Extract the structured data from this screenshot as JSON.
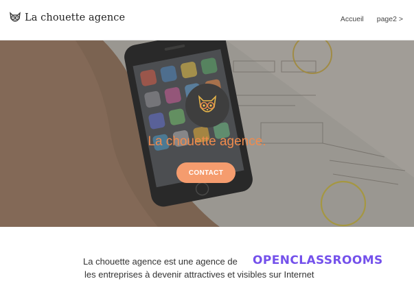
{
  "header": {
    "brand": "La chouette agence",
    "nav": [
      {
        "label": "Accueil"
      },
      {
        "label": "page2 >"
      }
    ]
  },
  "hero": {
    "title": "La chouette agence.",
    "cta": "CONTACT"
  },
  "intro": {
    "line1": "La chouette agence est une agence de",
    "line2": "les entreprises à devenir attractives et visibles sur Internet"
  },
  "badge": {
    "text": "OPENCLASSROOMS"
  },
  "colors": {
    "accent": "#f08b4d",
    "cta": "#f59c6e",
    "openclassrooms": "#7451eb"
  }
}
